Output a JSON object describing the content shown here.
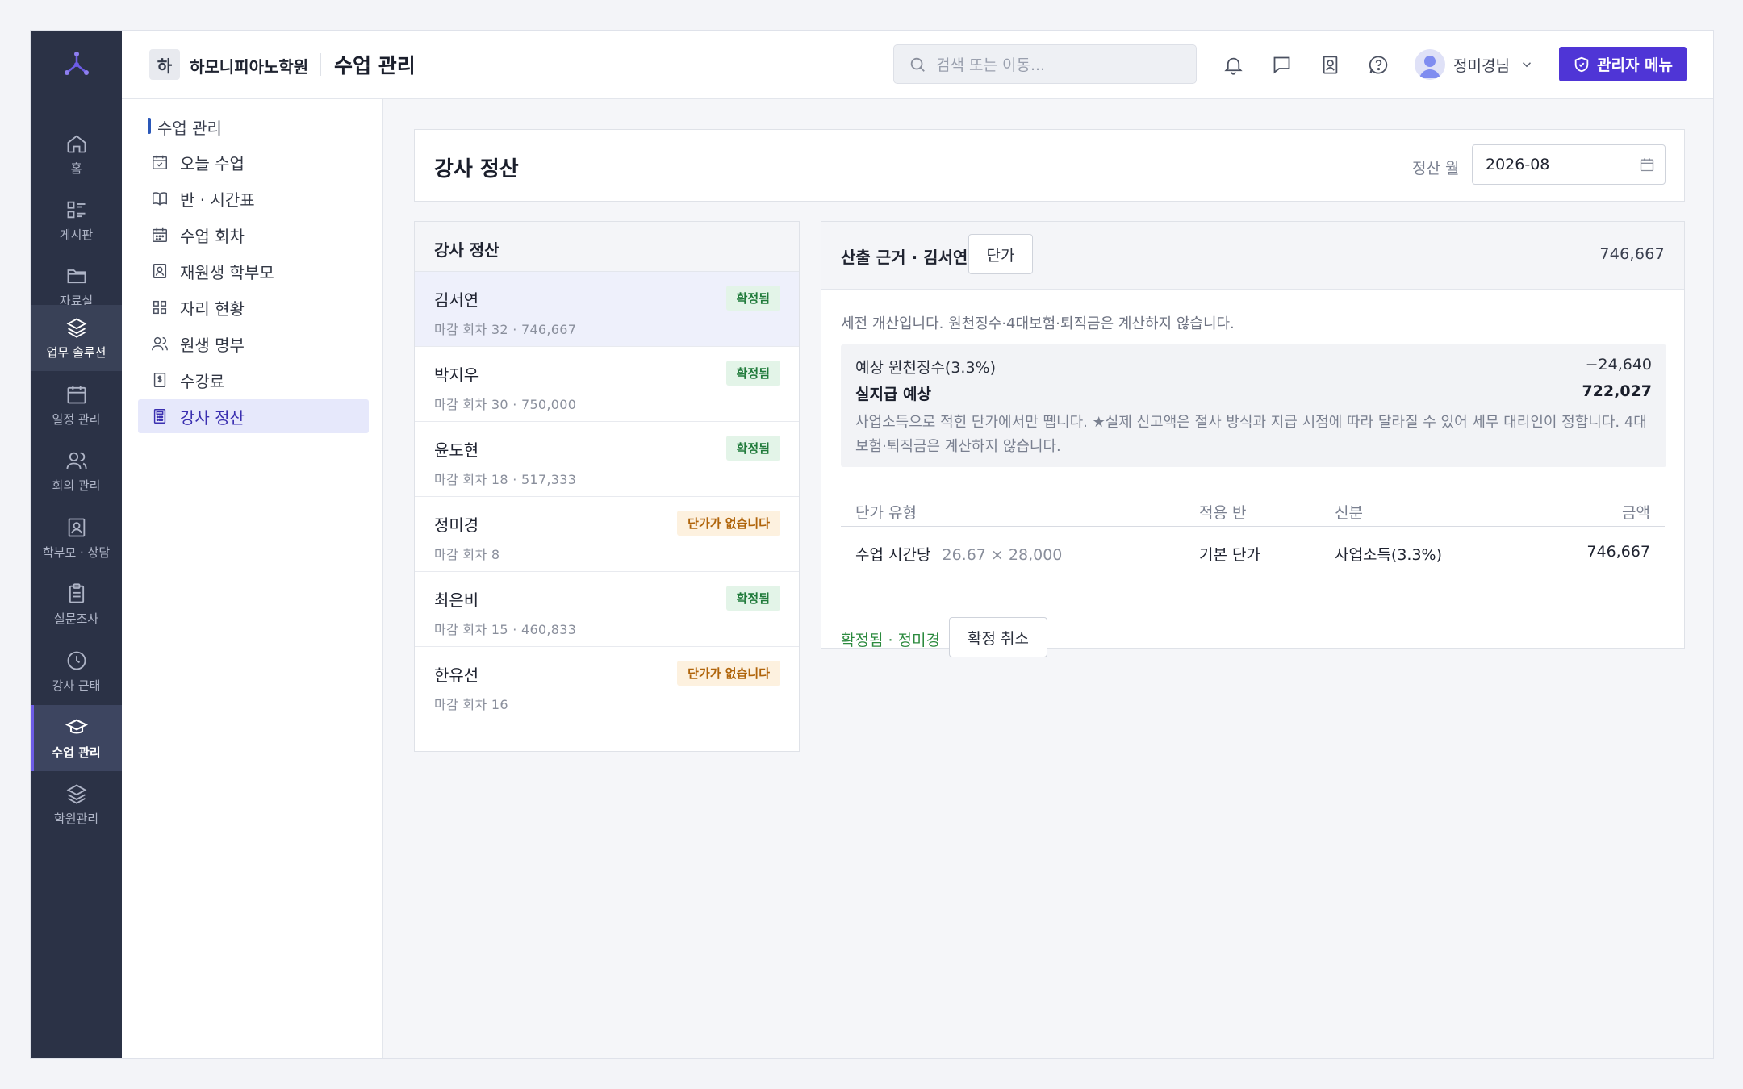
{
  "rail": {
    "items": [
      {
        "label": "홈",
        "icon": "home-icon"
      },
      {
        "label": "게시판",
        "icon": "board-icon"
      },
      {
        "label": "자료실",
        "icon": "folder-icon"
      },
      {
        "label": "업무 솔루션",
        "icon": "layers-icon"
      },
      {
        "label": "일정 관리",
        "icon": "calendar-icon"
      },
      {
        "label": "회의 관리",
        "icon": "users-icon"
      },
      {
        "label": "학부모 · 상담",
        "icon": "contact-icon"
      },
      {
        "label": "설문조사",
        "icon": "clipboard-icon"
      },
      {
        "label": "강사 근태",
        "icon": "clock-icon"
      },
      {
        "label": "수업 관리",
        "icon": "graduation-cap-icon"
      },
      {
        "label": "학원관리",
        "icon": "stack-icon"
      }
    ]
  },
  "topbar": {
    "org_initial": "하",
    "org_name": "하모니피아노학원",
    "page_title": "수업 관리",
    "search_placeholder": "검색 또는 이동...",
    "user_name": "정미경님",
    "admin_label": "관리자 메뉴"
  },
  "submenu": {
    "heading": "수업 관리",
    "items": [
      {
        "label": "오늘 수업",
        "icon": "calendar-check-icon"
      },
      {
        "label": "반 · 시간표",
        "icon": "book-icon"
      },
      {
        "label": "수업 회차",
        "icon": "calendar-grid-icon"
      },
      {
        "label": "재원생 학부모",
        "icon": "contact-card-icon"
      },
      {
        "label": "자리 현황",
        "icon": "grid-icon"
      },
      {
        "label": "원생 명부",
        "icon": "users-icon"
      },
      {
        "label": "수강료",
        "icon": "dollar-doc-icon"
      },
      {
        "label": "강사 정산",
        "icon": "calculator-icon"
      }
    ]
  },
  "header": {
    "title": "강사 정산",
    "month_label": "정산 월",
    "month_value": "2026-08"
  },
  "teacher_list": {
    "heading": "강사 정산",
    "rows": [
      {
        "name": "김서연",
        "meta": "마감 회차 32 · 746,667",
        "badge": "확정됨",
        "status": "ok"
      },
      {
        "name": "박지우",
        "meta": "마감 회차 30 · 750,000",
        "badge": "확정됨",
        "status": "ok"
      },
      {
        "name": "윤도현",
        "meta": "마감 회차 18 · 517,333",
        "badge": "확정됨",
        "status": "ok"
      },
      {
        "name": "정미경",
        "meta": "마감 회차 8",
        "badge": "단가가 없습니다",
        "status": "warn"
      },
      {
        "name": "최은비",
        "meta": "마감 회차 15 · 460,833",
        "badge": "확정됨",
        "status": "ok"
      },
      {
        "name": "한유선",
        "meta": "마감 회차 16",
        "badge": "단가가 없습니다",
        "status": "warn"
      }
    ]
  },
  "detail": {
    "title": "산출 근거 · 김서연",
    "unit_button": "단가",
    "total": "746,667",
    "note": "세전 개산입니다. 원천징수·4대보험·퇴직금은 계산하지 않습니다.",
    "withholding_label": "예상 원천징수(3.3%)",
    "withholding_value": "−24,640",
    "net_label": "실지급 예상",
    "net_value": "722,027",
    "summary_note": "사업소득으로 적힌 단가에서만 뗍니다. ★실제 신고액은 절사 방식과 지급 시점에 따라 달라질 수 있어 세무 대리인이 정합니다. 4대보험·퇴직금은 계산하지 않습니다.",
    "table": {
      "headers": [
        "단가 유형",
        "적용 반",
        "신분",
        "금액"
      ],
      "row": {
        "type": "수업 시간당",
        "formula": "26.67 × 28,000",
        "class": "기본 단가",
        "status": "사업소득(3.3%)",
        "amount": "746,667"
      }
    },
    "confirmed_label": "확정됨 · 정미경",
    "cancel_label": "확정 취소"
  },
  "colors": {
    "rail_bg": "#2b3246",
    "accent": "#4f35d6",
    "ok": "#1f7a3a",
    "warn": "#b0640a"
  }
}
